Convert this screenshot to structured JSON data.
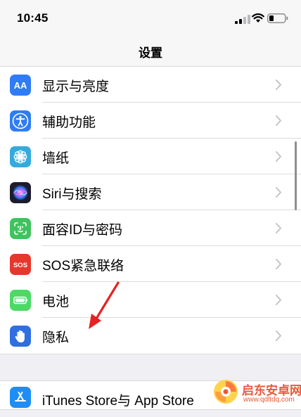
{
  "status_bar": {
    "time": "10:45"
  },
  "nav": {
    "title": "设置"
  },
  "settings": [
    {
      "label": "显示与亮度",
      "icon": "display-brightness-icon",
      "icon_text": "AA",
      "color": "#2f7cf6"
    },
    {
      "label": "辅助功能",
      "icon": "accessibility-icon",
      "color": "#2f7cf6"
    },
    {
      "label": "墙纸",
      "icon": "wallpaper-flower-icon",
      "color": "#36aadc"
    },
    {
      "label": "Siri与搜索",
      "icon": "siri-icon",
      "color": "#1c1c2e"
    },
    {
      "label": "面容ID与密码",
      "icon": "face-id-icon",
      "color": "#3fc35f"
    },
    {
      "label": "SOS紧急联络",
      "icon": "sos-icon",
      "icon_text": "SOS",
      "color": "#e5372c"
    },
    {
      "label": "电池",
      "icon": "battery-icon",
      "color": "#4cd964"
    },
    {
      "label": "隐私",
      "icon": "privacy-hand-icon",
      "color": "#2f6fe0"
    }
  ],
  "settings_2": [
    {
      "label": "iTunes Store与 App Store",
      "icon": "app-store-icon",
      "color": "#1e8ef5"
    }
  ],
  "watermark": {
    "name": "启东安卓网",
    "url": "www.qdltdq.com"
  }
}
